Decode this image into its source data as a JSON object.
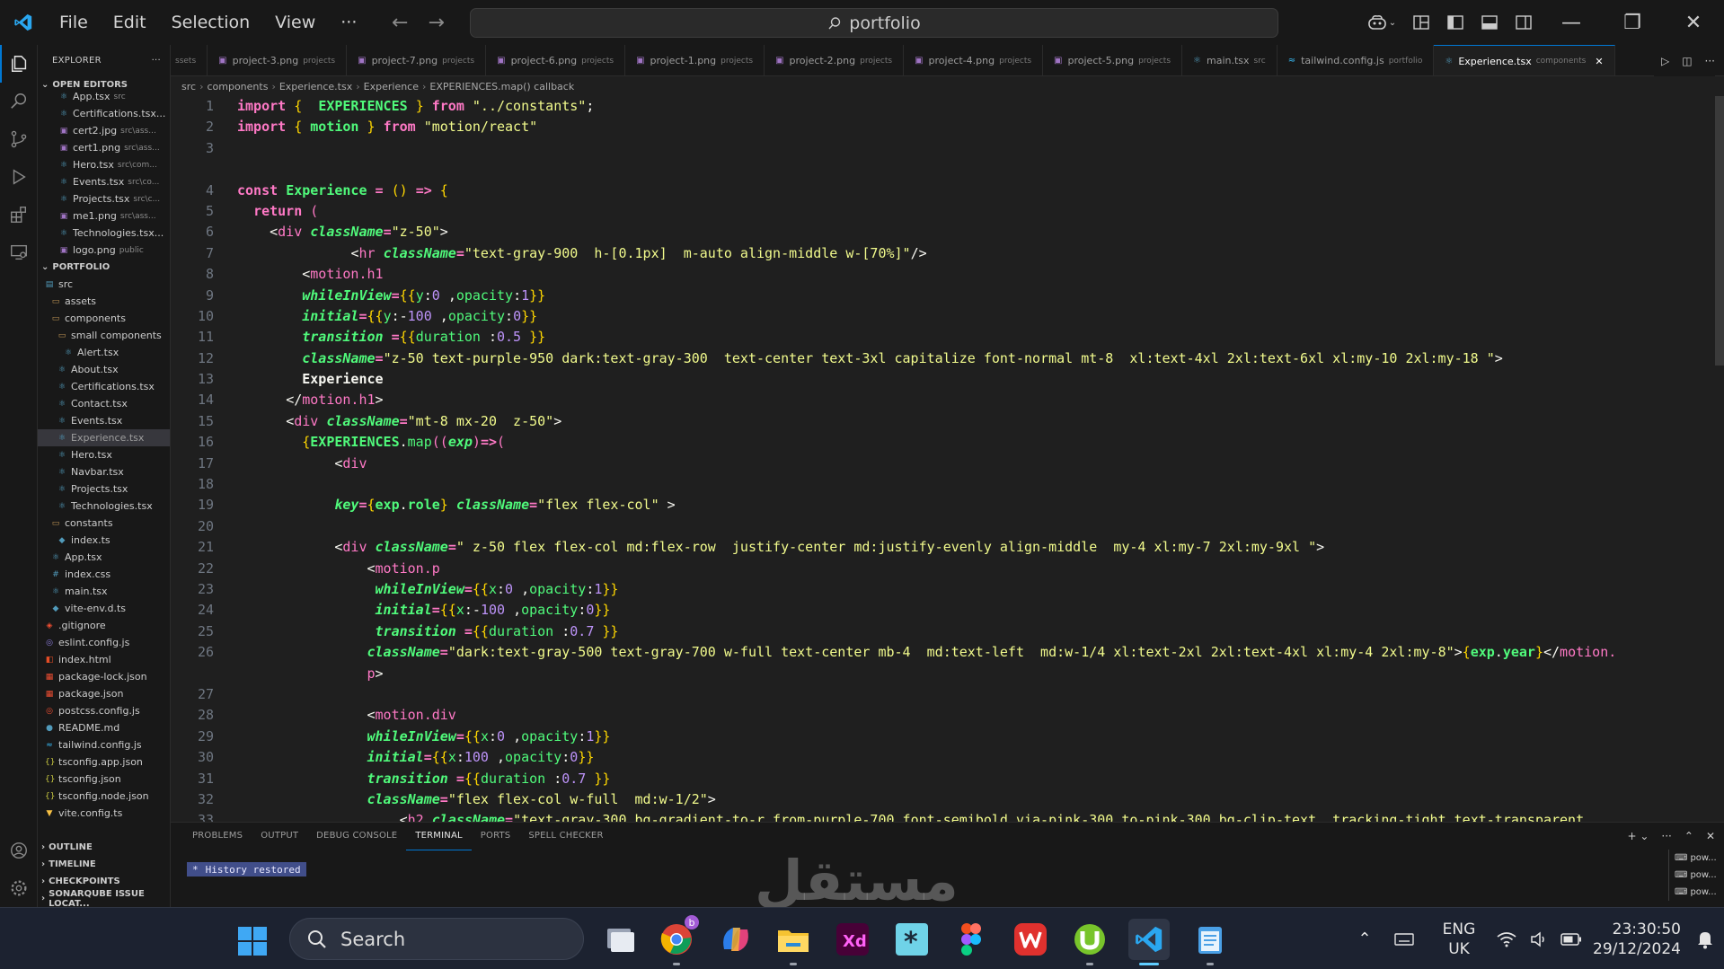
{
  "titlebar": {
    "menu": [
      "File",
      "Edit",
      "Selection",
      "View",
      "···"
    ],
    "search_text": "portfolio"
  },
  "sidebar": {
    "title": "EXPLORER",
    "open_editors_label": "OPEN EDITORS",
    "open_editors": [
      {
        "name": "App.tsx",
        "hint": "src",
        "icon": "react"
      },
      {
        "name": "Certifications.tsx...",
        "hint": "",
        "icon": "react"
      },
      {
        "name": "cert2.jpg",
        "hint": "src\\ass...",
        "icon": "image"
      },
      {
        "name": "cert1.png",
        "hint": "src\\ass...",
        "icon": "image"
      },
      {
        "name": "Hero.tsx",
        "hint": "src\\com...",
        "icon": "react"
      },
      {
        "name": "Events.tsx",
        "hint": "src\\co...",
        "icon": "react"
      },
      {
        "name": "Projects.tsx",
        "hint": "src\\c...",
        "icon": "react"
      },
      {
        "name": "me1.png",
        "hint": "src\\ass...",
        "icon": "image"
      },
      {
        "name": "Technologies.tsx...",
        "hint": "",
        "icon": "react"
      },
      {
        "name": "logo.png",
        "hint": "public",
        "icon": "image"
      }
    ],
    "project_label": "PORTFOLIO",
    "tree": [
      {
        "name": "src",
        "depth": 0,
        "icon": "folder-src"
      },
      {
        "name": "assets",
        "depth": 1,
        "icon": "folder"
      },
      {
        "name": "components",
        "depth": 1,
        "icon": "folder"
      },
      {
        "name": "small components",
        "depth": 2,
        "icon": "folder"
      },
      {
        "name": "Alert.tsx",
        "depth": 3,
        "icon": "react"
      },
      {
        "name": "About.tsx",
        "depth": 2,
        "icon": "react"
      },
      {
        "name": "Certifications.tsx",
        "depth": 2,
        "icon": "react"
      },
      {
        "name": "Contact.tsx",
        "depth": 2,
        "icon": "react"
      },
      {
        "name": "Events.tsx",
        "depth": 2,
        "icon": "react"
      },
      {
        "name": "Experience.tsx",
        "depth": 2,
        "icon": "react",
        "selected": true
      },
      {
        "name": "Hero.tsx",
        "depth": 2,
        "icon": "react"
      },
      {
        "name": "Navbar.tsx",
        "depth": 2,
        "icon": "react"
      },
      {
        "name": "Projects.tsx",
        "depth": 2,
        "icon": "react"
      },
      {
        "name": "Technologies.tsx",
        "depth": 2,
        "icon": "react"
      },
      {
        "name": "constants",
        "depth": 1,
        "icon": "folder"
      },
      {
        "name": "index.ts",
        "depth": 2,
        "icon": "ts"
      },
      {
        "name": "App.tsx",
        "depth": 1,
        "icon": "react"
      },
      {
        "name": "index.css",
        "depth": 1,
        "icon": "css"
      },
      {
        "name": "main.tsx",
        "depth": 1,
        "icon": "react"
      },
      {
        "name": "vite-env.d.ts",
        "depth": 1,
        "icon": "ts"
      },
      {
        "name": ".gitignore",
        "depth": 0,
        "icon": "git"
      },
      {
        "name": "eslint.config.js",
        "depth": 0,
        "icon": "eslint"
      },
      {
        "name": "index.html",
        "depth": 0,
        "icon": "html"
      },
      {
        "name": "package-lock.json",
        "depth": 0,
        "icon": "npm"
      },
      {
        "name": "package.json",
        "depth": 0,
        "icon": "npm"
      },
      {
        "name": "postcss.config.js",
        "depth": 0,
        "icon": "postcss"
      },
      {
        "name": "README.md",
        "depth": 0,
        "icon": "info"
      },
      {
        "name": "tailwind.config.js",
        "depth": 0,
        "icon": "tailwind"
      },
      {
        "name": "tsconfig.app.json",
        "depth": 0,
        "icon": "json"
      },
      {
        "name": "tsconfig.json",
        "depth": 0,
        "icon": "json"
      },
      {
        "name": "tsconfig.node.json",
        "depth": 0,
        "icon": "json"
      },
      {
        "name": "vite.config.ts",
        "depth": 0,
        "icon": "vite"
      }
    ],
    "bottom_sections": [
      "OUTLINE",
      "TIMELINE",
      "CHECKPOINTS",
      "SONARQUBE ISSUE LOCAT..."
    ]
  },
  "tabs": [
    {
      "name": "",
      "hint": "ssets",
      "icon": "none"
    },
    {
      "name": "project-3.png",
      "hint": "projects",
      "icon": "image"
    },
    {
      "name": "project-7.png",
      "hint": "projects",
      "icon": "image"
    },
    {
      "name": "project-6.png",
      "hint": "projects",
      "icon": "image"
    },
    {
      "name": "project-1.png",
      "hint": "projects",
      "icon": "image"
    },
    {
      "name": "project-2.png",
      "hint": "projects",
      "icon": "image"
    },
    {
      "name": "project-4.png",
      "hint": "projects",
      "icon": "image"
    },
    {
      "name": "project-5.png",
      "hint": "projects",
      "icon": "image"
    },
    {
      "name": "main.tsx",
      "hint": "src",
      "icon": "react"
    },
    {
      "name": "tailwind.config.js",
      "hint": "portfolio",
      "icon": "tailwind"
    },
    {
      "name": "Experience.tsx",
      "hint": "components",
      "icon": "react",
      "active": true
    }
  ],
  "breadcrumb": [
    "src",
    "components",
    "Experience.tsx",
    "Experience",
    "EXPERIENCES.map() callback"
  ],
  "editor": {
    "line_numbers": [
      "1",
      "2",
      "3",
      "",
      "4",
      "5",
      "6",
      "7",
      "8",
      "9",
      "10",
      "11",
      "12",
      "13",
      "14",
      "15",
      "16",
      "17",
      "18",
      "19",
      "20",
      "21",
      "22",
      "23",
      "24",
      "25",
      "26",
      "",
      "27",
      "28",
      "29",
      "30",
      "31",
      "32",
      "33"
    ]
  },
  "panel": {
    "tabs": [
      "PROBLEMS",
      "OUTPUT",
      "DEBUG CONSOLE",
      "TERMINAL",
      "PORTS",
      "SPELL CHECKER"
    ],
    "active_tab": "TERMINAL",
    "terminal_message": "History restored",
    "terminals": [
      "pow...",
      "pow...",
      "pow..."
    ]
  },
  "watermark": "مستقل",
  "taskbar": {
    "search_label": "Search",
    "lang_top": "ENG",
    "lang_bottom": "UK",
    "time": "23:30:50",
    "date": "29/12/2024",
    "chrome_badge": "b"
  },
  "colors": {
    "accent": "#0078d4",
    "keyword": "#ff79c6",
    "identifier": "#50fa7b",
    "string": "#f1fa8c",
    "brace": "#ffd700"
  }
}
